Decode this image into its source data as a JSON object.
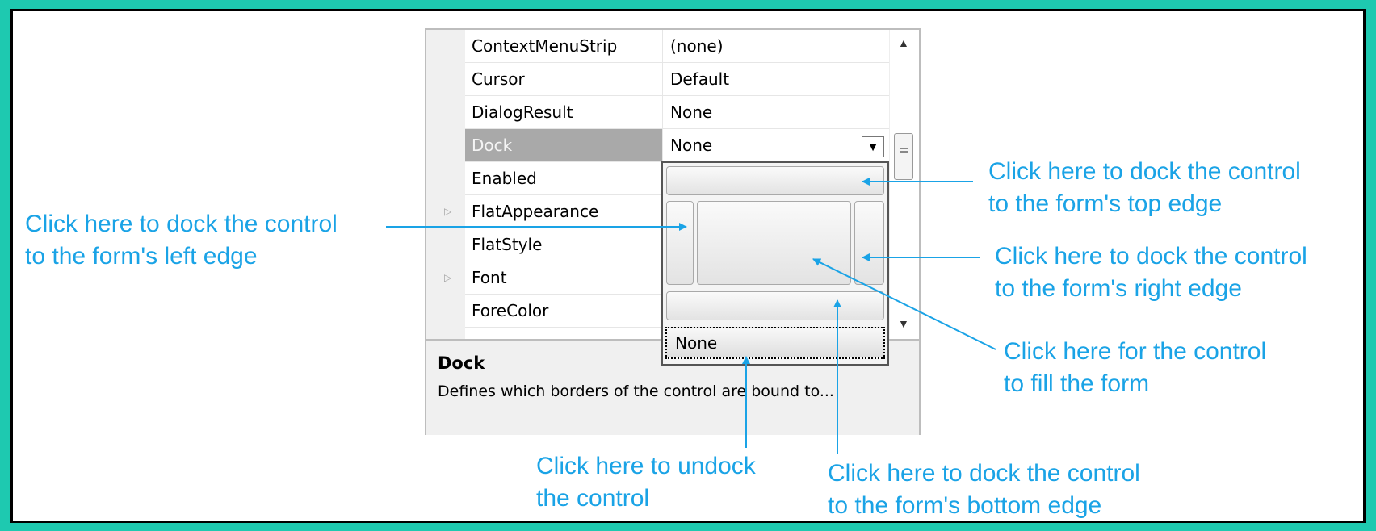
{
  "properties": {
    "rows": [
      {
        "name": "ContextMenuStrip",
        "value": "(none)",
        "expandable": false
      },
      {
        "name": "Cursor",
        "value": "Default",
        "expandable": false
      },
      {
        "name": "DialogResult",
        "value": "None",
        "expandable": false
      },
      {
        "name": "Dock",
        "value": "None",
        "expandable": false,
        "selected": true
      },
      {
        "name": "Enabled",
        "value": "",
        "expandable": false
      },
      {
        "name": "FlatAppearance",
        "value": "",
        "expandable": true
      },
      {
        "name": "FlatStyle",
        "value": "",
        "expandable": false
      },
      {
        "name": "Font",
        "value": "",
        "expandable": true
      },
      {
        "name": "ForeColor",
        "value": "",
        "expandable": false
      }
    ],
    "description": {
      "title": "Dock",
      "text": "Defines which borders of the control are bound to..."
    }
  },
  "dock_editor": {
    "none_label": "None"
  },
  "callouts": {
    "left": [
      "Click here to dock the control",
      "to the form's left edge"
    ],
    "top": [
      "Click here to dock the control",
      "to the form's top edge"
    ],
    "right": [
      "Click here to dock the control",
      "to the form's right edge"
    ],
    "fill": [
      "Click here for the control",
      "to fill the form"
    ],
    "undock": [
      "Click here to undock",
      "the control"
    ],
    "bottom": [
      "Click here to dock the control",
      "to the form's bottom edge"
    ]
  },
  "colors": {
    "frame": "#1ec9b0",
    "callout_text": "#1aa3e6",
    "callout_line": "#1aa3e6",
    "selected_row": "#a9a9a9"
  }
}
